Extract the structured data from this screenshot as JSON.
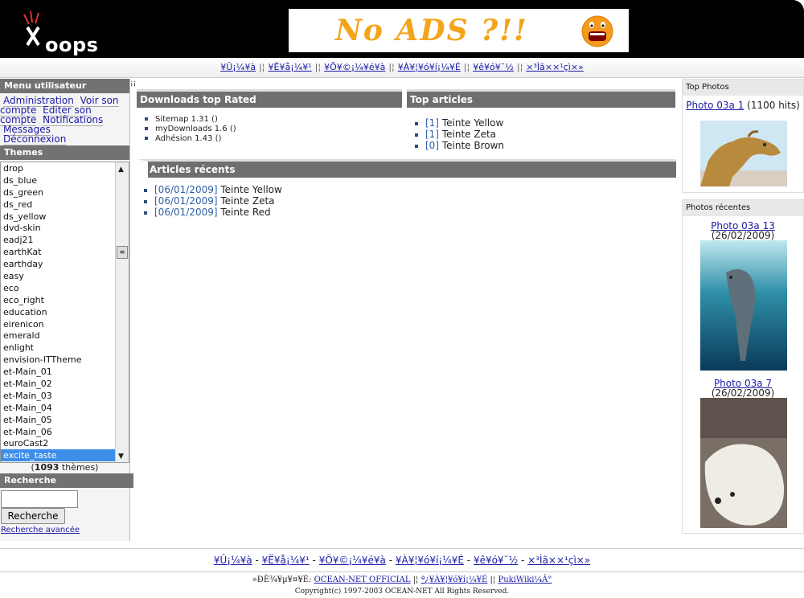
{
  "header": {
    "logo_text": "oops",
    "banner_text": "No ADS ?!!"
  },
  "topnav": {
    "links": [
      "¥Û¡¼¥à",
      "¥Ë¥å¡¼¥¹",
      "¥Õ¥©¡¼¥é¥à",
      "¥À¥¦¥ó¥í¡¼¥É",
      "¥ê¥ó¥¯½",
      "×³Ìã××¹çì×»"
    ],
    "separator": "|¦"
  },
  "user_menu": {
    "title": "Menu utilisateur",
    "items": [
      "Administration",
      "Voir son compte",
      "Editer son compte",
      "Notifications",
      "Messages",
      "Déconnexion"
    ]
  },
  "themes": {
    "title": "Themes",
    "items": [
      "drop",
      "ds_blue",
      "ds_green",
      "ds_red",
      "ds_yellow",
      "dvd-skin",
      "eadj21",
      "earthKat",
      "earthday",
      "easy",
      "eco",
      "eco_right",
      "education",
      "eirenicon",
      "emerald",
      "enlight",
      "envision-ITTheme",
      "et-Main_01",
      "et-Main_02",
      "et-Main_03",
      "et-Main_04",
      "et-Main_05",
      "et-Main_06",
      "euroCast2",
      "excite_taste"
    ],
    "selected": "excite_taste",
    "count": "1093",
    "count_suffix": " thèmes)",
    "count_prefix": "("
  },
  "search": {
    "title": "Recherche",
    "button": "Recherche",
    "advanced": "Recherche avancée"
  },
  "downloads": {
    "title": "Downloads top Rated",
    "items": [
      "Sitemap 1.31 ()",
      "myDownloads 1.6 ()",
      "Adhésion 1.43 ()"
    ]
  },
  "top_articles": {
    "title": "Top articles",
    "items": [
      {
        "count": "[1]",
        "name": "Teinte Yellow"
      },
      {
        "count": "[1]",
        "name": "Teinte Zeta"
      },
      {
        "count": "[0]",
        "name": "Teinte Brown"
      }
    ]
  },
  "recent_articles": {
    "title": "Articles récents",
    "items": [
      {
        "date": "[06/01/2009]",
        "name": "Teinte Yellow"
      },
      {
        "date": "[06/01/2009]",
        "name": "Teinte Zeta"
      },
      {
        "date": "[06/01/2009]",
        "name": "Teinte Red"
      }
    ]
  },
  "top_photos": {
    "title": "Top Photos",
    "photo_link": "Photo 03a 1",
    "photo_meta": " (1100 hits)"
  },
  "recent_photos": {
    "title": "Photos récentes",
    "photo1_link": "Photo 03a 13",
    "photo1_meta": " (26/02/2009)",
    "photo2_link": "Photo 03a 7",
    "photo2_meta": " (26/02/2009)"
  },
  "footer": {
    "links": [
      "¥Û¡¼¥à",
      "¥Ë¥å¡¼¥¹",
      "¥Õ¥©¡¼¥é¥à",
      "¥À¥¦¥ó¥í¡¼¥É",
      "¥ê¥ó¥¯½",
      "×³Ìã××¹çì×»"
    ],
    "separator": " - ",
    "powered_prefix": "»ÐÈ¾¥µ¥¤¥È: ",
    "powered_links": [
      "OCEAN-NET OFFICIAL",
      "ª¿¥À¥¦¥ó¥í¡¼¥É",
      "PukiWiki¼Â°"
    ],
    "powered_sep": " |¦ ",
    "copyright": "Copyright(c) 1997-2003 OCEAN-NET All Rights Reserved."
  },
  "colors": {
    "header_bg": "#000000",
    "block_title_bg": "#727272",
    "link": "#1a1aa6",
    "selected_bg": "#3d8ee8"
  }
}
